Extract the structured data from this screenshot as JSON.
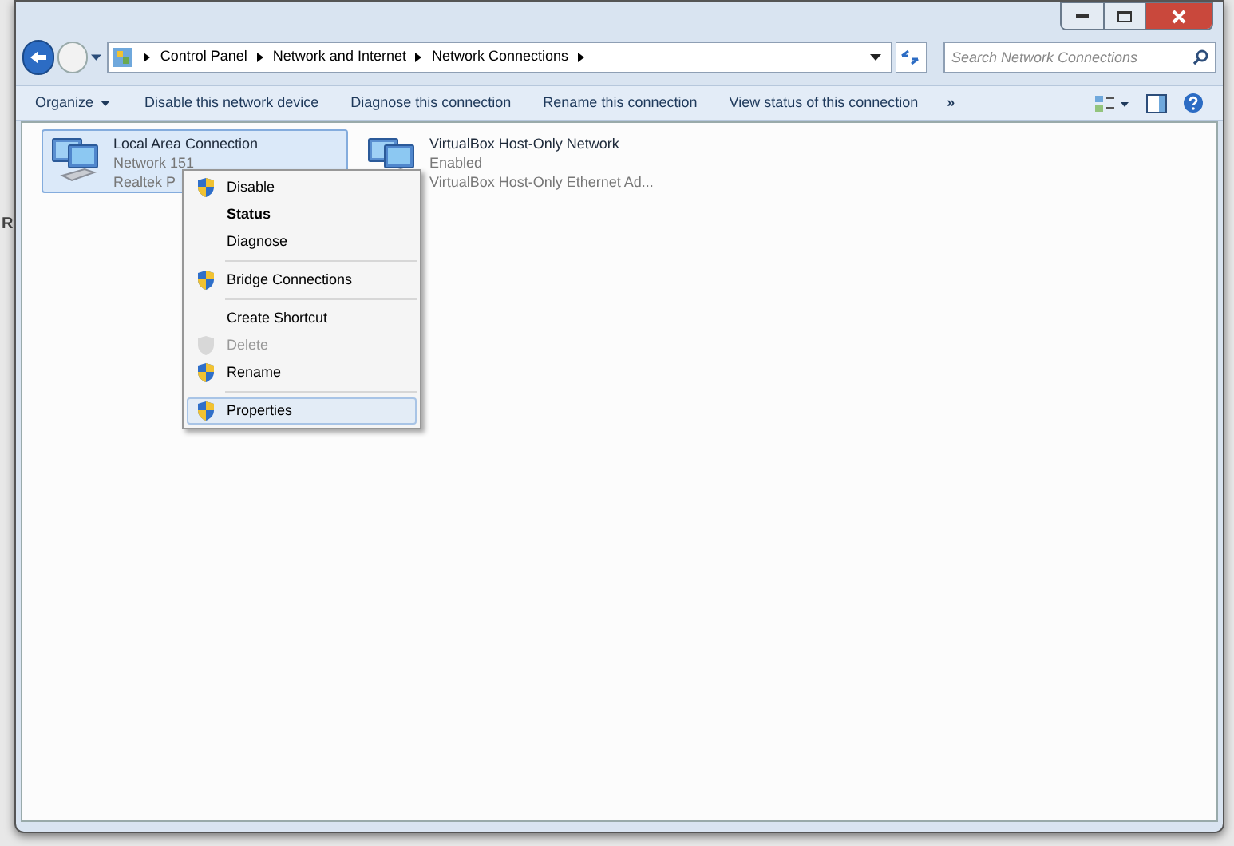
{
  "edge_text": "R",
  "address_bar": {
    "crumbs": [
      "Control Panel",
      "Network and Internet",
      "Network Connections"
    ]
  },
  "search": {
    "placeholder": "Search Network Connections"
  },
  "toolbar": {
    "organize": "Organize",
    "commands": [
      "Disable this network device",
      "Diagnose this connection",
      "Rename this connection",
      "View status of this connection"
    ],
    "more": "»"
  },
  "connections": [
    {
      "name": "Local Area Connection",
      "status": "Network 151",
      "device": "Realtek P",
      "selected": true
    },
    {
      "name": "VirtualBox Host-Only Network",
      "status": "Enabled",
      "device": "VirtualBox Host-Only Ethernet Ad...",
      "selected": false
    }
  ],
  "context_menu": [
    {
      "kind": "item",
      "label": "Disable",
      "shield": true,
      "default": false,
      "disabled": false,
      "selected": false
    },
    {
      "kind": "item",
      "label": "Status",
      "shield": false,
      "default": true,
      "disabled": false,
      "selected": false
    },
    {
      "kind": "item",
      "label": "Diagnose",
      "shield": false,
      "default": false,
      "disabled": false,
      "selected": false
    },
    {
      "kind": "separator"
    },
    {
      "kind": "item",
      "label": "Bridge Connections",
      "shield": true,
      "default": false,
      "disabled": false,
      "selected": false
    },
    {
      "kind": "separator"
    },
    {
      "kind": "item",
      "label": "Create Shortcut",
      "shield": false,
      "default": false,
      "disabled": false,
      "selected": false
    },
    {
      "kind": "item",
      "label": "Delete",
      "shield": true,
      "default": false,
      "disabled": true,
      "selected": false
    },
    {
      "kind": "item",
      "label": "Rename",
      "shield": true,
      "default": false,
      "disabled": false,
      "selected": false
    },
    {
      "kind": "separator"
    },
    {
      "kind": "item",
      "label": "Properties",
      "shield": true,
      "default": false,
      "disabled": false,
      "selected": true
    }
  ]
}
